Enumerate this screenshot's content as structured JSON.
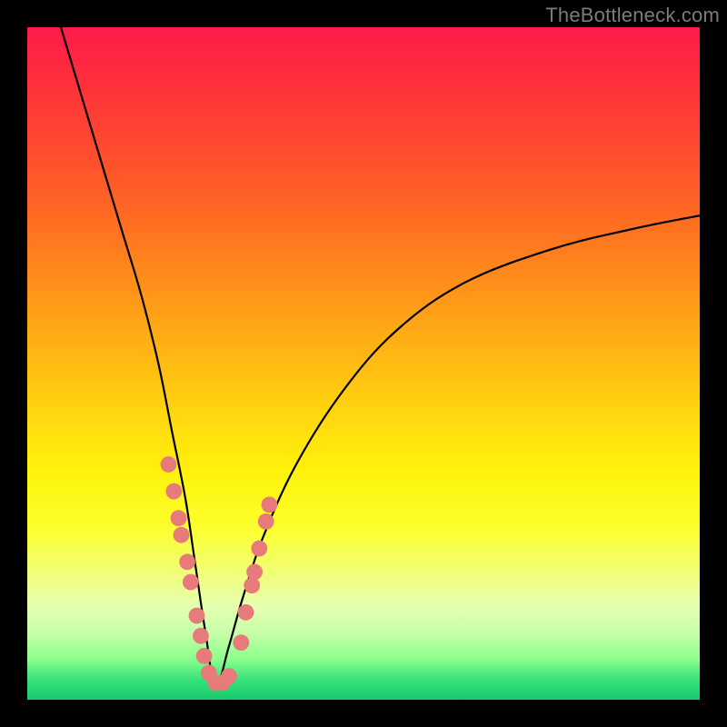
{
  "watermark": "TheBottleneck.com",
  "colors": {
    "frame_bg": "#000000",
    "curve": "#000000",
    "dot": "#e77a7a",
    "gradient_stops": [
      "#ff1a4b",
      "#ff2f3c",
      "#ff4a2f",
      "#ff6a22",
      "#ff8f1a",
      "#ffb414",
      "#ffd80f",
      "#fff20c",
      "#fdff2a",
      "#f3ff6a",
      "#e6ffb0",
      "#c8ffa8",
      "#8bff8b",
      "#37e27a",
      "#18c96e"
    ]
  },
  "chart_data": {
    "type": "line",
    "title": "",
    "xlabel": "",
    "ylabel": "",
    "xlim": [
      0,
      100
    ],
    "ylim": [
      0,
      100
    ],
    "curve": {
      "description": "V-shaped bottleneck curve; minimum (best/green) at x≈28, both arms rise toward red.",
      "min_x": 28,
      "min_y": 2,
      "left_arm": {
        "x_start": 5,
        "y_start": 100
      },
      "right_arm": {
        "x_end": 100,
        "y_end": 72
      },
      "left_points_xy": [
        [
          5,
          100
        ],
        [
          8,
          90
        ],
        [
          11,
          80
        ],
        [
          14,
          70
        ],
        [
          17,
          60
        ],
        [
          19.5,
          50
        ],
        [
          21.5,
          40
        ],
        [
          23.5,
          30
        ],
        [
          25,
          20
        ],
        [
          26.5,
          10
        ],
        [
          28,
          2
        ]
      ],
      "right_points_xy": [
        [
          28,
          2
        ],
        [
          30,
          8
        ],
        [
          32,
          15
        ],
        [
          35,
          24
        ],
        [
          40,
          35
        ],
        [
          47,
          46
        ],
        [
          55,
          55
        ],
        [
          65,
          62
        ],
        [
          78,
          67
        ],
        [
          90,
          70
        ],
        [
          100,
          72
        ]
      ]
    },
    "dots_xy": [
      [
        21.0,
        35.0
      ],
      [
        21.8,
        31.0
      ],
      [
        22.5,
        27.0
      ],
      [
        22.9,
        24.5
      ],
      [
        23.8,
        20.5
      ],
      [
        24.3,
        17.5
      ],
      [
        25.2,
        12.5
      ],
      [
        25.8,
        9.5
      ],
      [
        26.3,
        6.5
      ],
      [
        27.0,
        4.0
      ],
      [
        28.0,
        2.5
      ],
      [
        29.0,
        2.5
      ],
      [
        30.0,
        3.5
      ],
      [
        31.8,
        8.5
      ],
      [
        32.5,
        13.0
      ],
      [
        33.4,
        17.0
      ],
      [
        33.8,
        19.0
      ],
      [
        34.5,
        22.5
      ],
      [
        35.5,
        26.5
      ],
      [
        36.0,
        29.0
      ]
    ],
    "dot_radius_pct": 1.2
  }
}
